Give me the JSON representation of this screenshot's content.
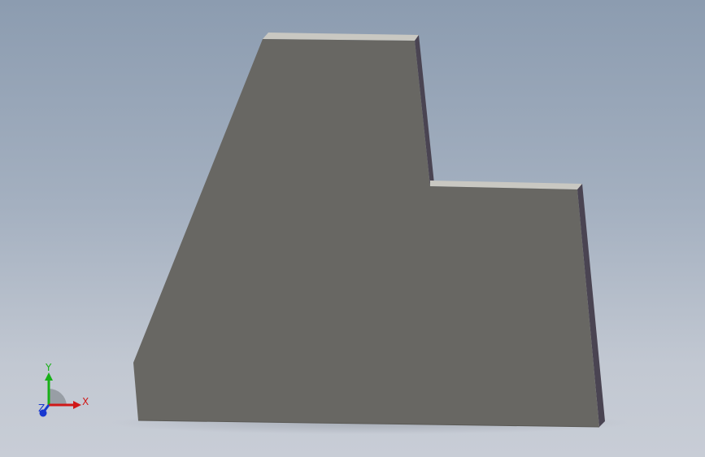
{
  "viewport": {
    "background_top": "#8c9cb0",
    "background_bottom": "#c8cdd6"
  },
  "model": {
    "face_color": "#686763",
    "top_edge_color": "#c9c8c2",
    "side_edge_color": "#4a4452"
  },
  "triad": {
    "x_label": "X",
    "y_label": "Y",
    "z_label": "Z",
    "x_color": "#d01818",
    "y_color": "#18b018",
    "z_color": "#1838d0"
  }
}
